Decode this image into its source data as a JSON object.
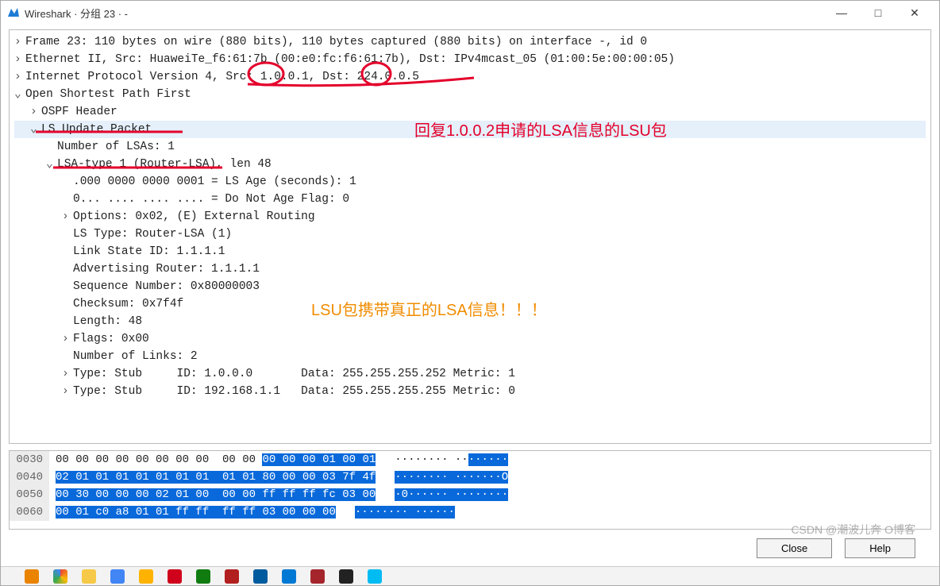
{
  "window": {
    "title": "Wireshark · 分组 23 · -",
    "controls": {
      "min": "—",
      "max": "□",
      "close": "✕"
    }
  },
  "tree": {
    "frame": "Frame 23: 110 bytes on wire (880 bits), 110 bytes captured (880 bits) on interface -, id 0",
    "eth": "Ethernet II, Src: HuaweiTe_f6:61:7b (00:e0:fc:f6:61:7b), Dst: IPv4mcast_05 (01:00:5e:00:00:05)",
    "ip": "Internet Protocol Version 4, Src: 1.0.0.1, Dst: 224.0.0.5",
    "ospf": "Open Shortest Path First",
    "ospf_hdr": "OSPF Header",
    "lsu": "LS Update Packet",
    "num_lsa": "Number of LSAs: 1",
    "lsa1": "LSA-type 1 (Router-LSA), len 48",
    "lsage": ".000 0000 0000 0001 = LS Age (seconds): 1",
    "dna": "0... .... .... .... = Do Not Age Flag: 0",
    "opts": "Options: 0x02, (E) External Routing",
    "lstype": "LS Type: Router-LSA (1)",
    "lsid": "Link State ID: 1.1.1.1",
    "advr": "Advertising Router: 1.1.1.1",
    "seq": "Sequence Number: 0x80000003",
    "cksum": "Checksum: 0x7f4f",
    "len": "Length: 48",
    "flags": "Flags: 0x00",
    "nlinks": "Number of Links: 2",
    "link1": "Type: Stub     ID: 1.0.0.0       Data: 255.255.255.252 Metric: 1",
    "link2": "Type: Stub     ID: 192.168.1.1   Data: 255.255.255.255 Metric: 0"
  },
  "annotations": {
    "red_text": "回复1.0.0.2申请的LSA信息的LSU包",
    "orange_text": "LSU包携带真正的LSA信息！！！"
  },
  "hex": {
    "rows": [
      {
        "off": "0030",
        "plain1": "00 00 00 00 00 00 00 00  00 00 ",
        "sel1": "00 00 00 01 00 01",
        "plain2": "",
        "ascii_plain": "········ ··",
        "ascii_sel": "······"
      },
      {
        "off": "0040",
        "plain1": "",
        "sel1": "02 01 01 01 01 01 01 01  01 01 80 00 00 03 7f 4f",
        "plain2": "",
        "ascii_plain": "",
        "ascii_sel": "········ ·······O"
      },
      {
        "off": "0050",
        "plain1": "",
        "sel1": "00 30 00 00 00 02 01 00  00 00 ff ff ff fc 03 00",
        "plain2": "",
        "ascii_plain": "",
        "ascii_sel": "·0······ ········"
      },
      {
        "off": "0060",
        "plain1": "",
        "sel1": "00 01 c0 a8 01 01 ff ff  ff ff 03 00 00 00",
        "plain2": "",
        "ascii_plain": "",
        "ascii_sel": "········ ······"
      }
    ]
  },
  "buttons": {
    "close": "Close",
    "help": "Help"
  },
  "watermark": "CSDN @潮波儿奔   O博客"
}
